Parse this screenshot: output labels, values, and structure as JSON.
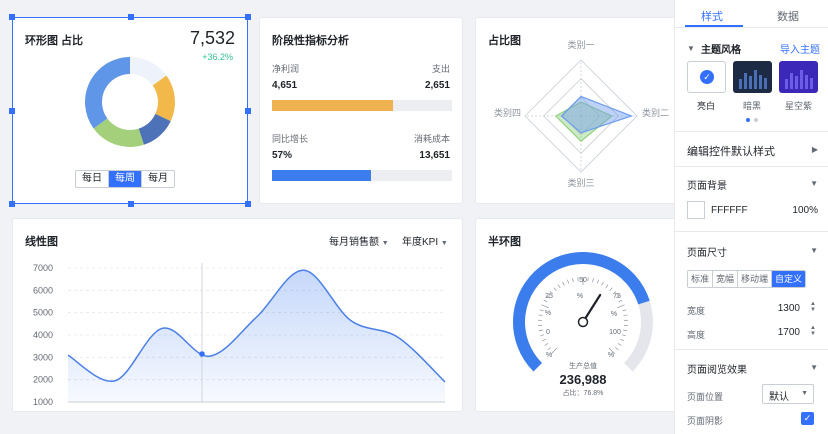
{
  "donut_card": {
    "title": "环形图 占比",
    "value": "7,532",
    "change": "+36.2%",
    "segments": [
      {
        "value": 15,
        "color": "#eef3fb"
      },
      {
        "value": 17,
        "color": "#f2b849"
      },
      {
        "value": 13,
        "color": "#4e72b8"
      },
      {
        "value": 20,
        "color": "#a5d07b"
      },
      {
        "value": 35,
        "color": "#5f96e8"
      }
    ],
    "periods": [
      "每日",
      "每周",
      "每月"
    ],
    "active_period": "每周"
  },
  "stage_card": {
    "title": "阶段性指标分析",
    "row1": {
      "left_label": "净利润",
      "right_label": "支出",
      "left_value": "4,651",
      "right_value": "2,651",
      "progress": 0.67,
      "color": "#eeb350"
    },
    "row2": {
      "left_label": "同比增长",
      "right_label": "消耗成本",
      "left_value": "57%",
      "right_value": "13,651",
      "progress": 0.55,
      "color": "#3b7ded"
    }
  },
  "radar_card": {
    "title": "占比图",
    "axes": [
      "类别一",
      "类别二",
      "类别三",
      "类别四"
    ],
    "series": [
      {
        "values": [
          0.25,
          0.55,
          0.45,
          0.45
        ],
        "color": "#8fd17e"
      },
      {
        "values": [
          0.35,
          0.9,
          0.3,
          0.35
        ],
        "color": "#6e9cf0"
      }
    ]
  },
  "line_card": {
    "title": "线性图",
    "dropdown1": "每月销售额",
    "dropdown2": "年度KPI",
    "y_ticks": [
      "7000",
      "6000",
      "5000",
      "4000",
      "3000",
      "2000",
      "1000"
    ]
  },
  "gauge_card": {
    "title": "半环图",
    "ticks": [
      "0",
      "25",
      "50",
      "75",
      "100"
    ],
    "pct_symbol": "%",
    "label": "生产总值",
    "value": "236,988",
    "sub": "占比：76.8%",
    "percent": 0.768
  },
  "chart_data": [
    {
      "type": "pie",
      "title": "环形图 占比",
      "values": [
        15,
        17,
        13,
        20,
        35
      ]
    },
    {
      "type": "line",
      "title": "线性图",
      "x": [
        0,
        1,
        2,
        3,
        4,
        5,
        6,
        7,
        8
      ],
      "values": [
        3100,
        1950,
        4300,
        3050,
        4800,
        6900,
        4650,
        3900,
        1900
      ],
      "ylim": [
        1000,
        7000
      ]
    }
  ],
  "panel": {
    "tabs": [
      "样式",
      "数据"
    ],
    "active_tab": "样式",
    "theme_title": "主题风格",
    "import_theme": "导入主题",
    "themes": [
      {
        "name": "亮白",
        "bg": "#ffffff"
      },
      {
        "name": "暗黑",
        "bg": "#1d2a44"
      },
      {
        "name": "星空紫",
        "bg": "#3b27b8"
      }
    ],
    "edit_default": "编辑控件默认样式",
    "bg_title": "页面背景",
    "bg_color": "FFFFFF",
    "bg_opacity": "100%",
    "size_title": "页面尺寸",
    "size_options": [
      "标准",
      "宽幅",
      "移动端",
      "自定义"
    ],
    "active_size": "自定义",
    "width_label": "宽度",
    "width_value": "1300",
    "height_label": "高度",
    "height_value": "1700",
    "browse_title": "页面阅览效果",
    "position_label": "页面位置",
    "position_value": "默认",
    "shadow_label": "页面阴影",
    "shadow_checked": true
  }
}
